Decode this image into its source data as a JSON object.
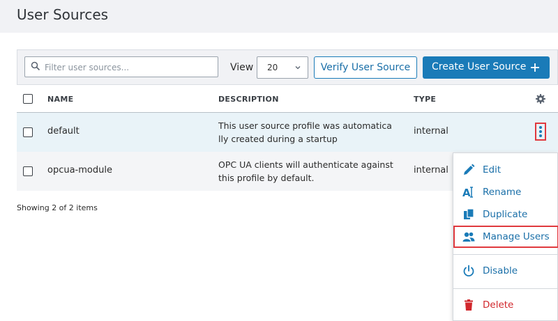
{
  "page": {
    "title": "User Sources"
  },
  "toolbar": {
    "search_placeholder": "Filter user sources...",
    "view_label": "View",
    "view_value": "20",
    "verify_label": "Verify User Source",
    "create_label": "Create User Source"
  },
  "table": {
    "headers": {
      "name": "NAME",
      "description": "DESCRIPTION",
      "type": "TYPE"
    },
    "rows": [
      {
        "name": "default",
        "desc_line1": "This user source profile was automatica",
        "desc_line2": "lly created during a startup",
        "type": "internal"
      },
      {
        "name": "opcua-module",
        "desc_line1": "OPC UA clients will authenticate against",
        "desc_line2": "this profile by default.",
        "type": "internal"
      }
    ]
  },
  "footer": {
    "showing": "Showing 2 of 2 items"
  },
  "menu": {
    "items": [
      {
        "label": "Edit",
        "icon": "pencil-icon"
      },
      {
        "label": "Rename",
        "icon": "rename-icon"
      },
      {
        "label": "Duplicate",
        "icon": "duplicate-icon"
      },
      {
        "label": "Manage Users",
        "icon": "users-icon"
      },
      {
        "label": "Disable",
        "icon": "power-icon"
      },
      {
        "label": "Delete",
        "icon": "trash-icon"
      }
    ]
  },
  "colors": {
    "accent": "#1a7bb8",
    "danger": "#d1272c",
    "highlight": "#e0393e"
  }
}
